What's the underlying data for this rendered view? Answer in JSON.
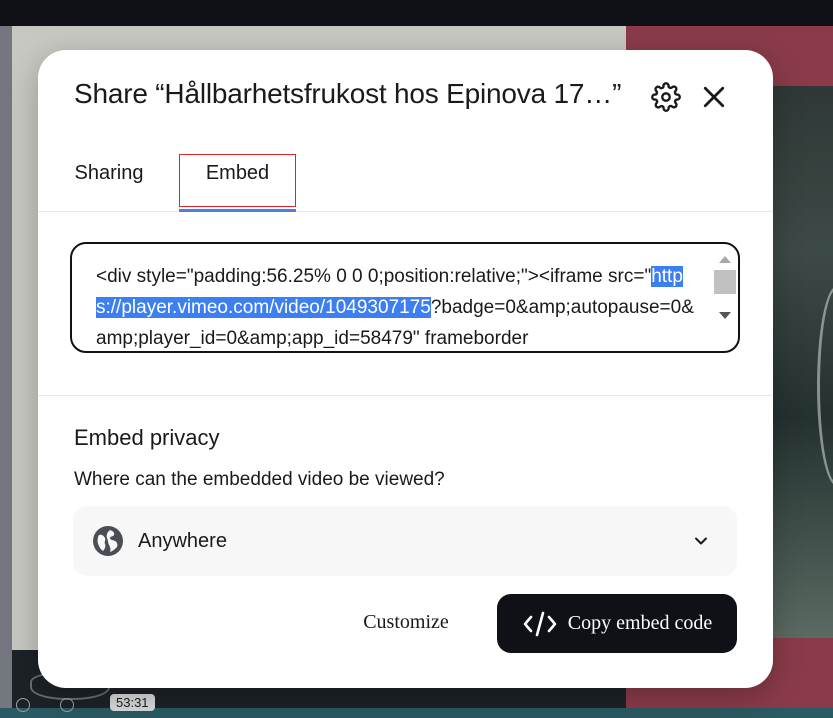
{
  "dialog": {
    "title": "Share “Hållbarhetsfrukost hos Epinova 17…”",
    "settings_icon": "gear-icon",
    "close_icon": "close-icon"
  },
  "tabs": [
    {
      "label": "Sharing",
      "selected": false
    },
    {
      "label": "Embed",
      "selected": true
    }
  ],
  "embed_code": {
    "before": "<div style=\"padding:56.25% 0 0 0;position:relative;\"><iframe src=\"",
    "highlighted": "https://player.vimeo.com/video/1049307175",
    "after": "?badge=0&amp;autopause=0&amp;player_id=0&amp;app_id=58479\" frameborder"
  },
  "privacy": {
    "title": "Embed privacy",
    "question": "Where can the embedded video be viewed?",
    "selected_option": "Anywhere",
    "option_icon": "globe-icon"
  },
  "actions": {
    "customize_label": "Customize",
    "copy_label": "Copy embed code",
    "copy_icon": "code-icon"
  },
  "player": {
    "timecode": "53:31"
  },
  "colors": {
    "accent_underline": "#4d7ed8",
    "selection_highlight": "#3d7ff0",
    "primary_button": "#0f1117",
    "focus_outline": "#e0232a"
  }
}
